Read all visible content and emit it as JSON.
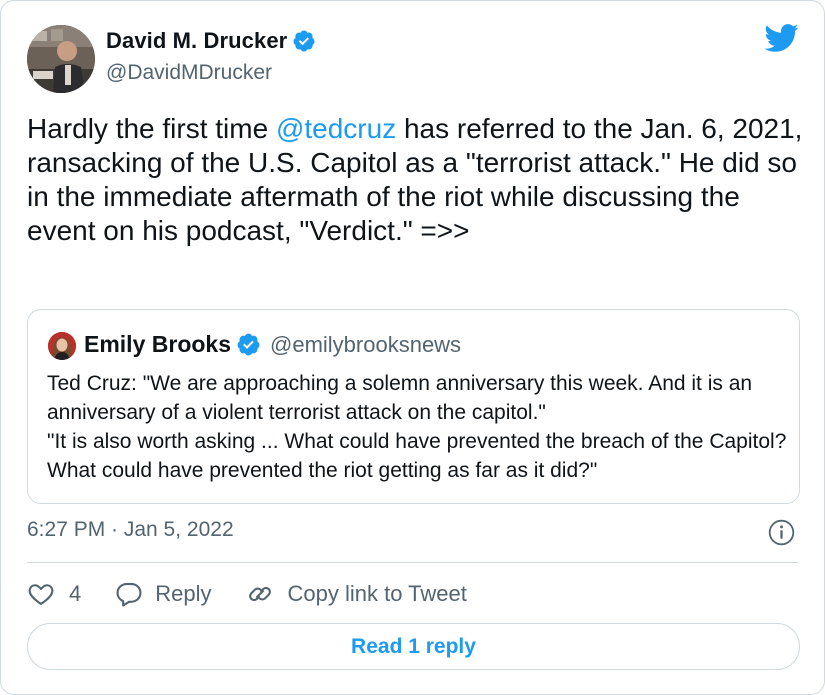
{
  "author": {
    "name": "David M. Drucker",
    "handle": "@DavidMDrucker"
  },
  "tweet": {
    "text_before": "Hardly the first time ",
    "mention": "@tedcruz",
    "text_after": " has referred to the Jan. 6, 2021, ransacking of the U.S. Capitol as a \"terrorist attack.\" He did so in the immediate aftermath of the riot while discussing the event on his podcast, \"Verdict.\" =>>"
  },
  "quoted_tweet": {
    "name": "Emily Brooks",
    "handle": "@emilybrooksnews",
    "text": "Ted Cruz: \"We are approaching a solemn anniversary this week. And it is an anniversary of a violent terrorist attack on the capitol.\"\n\"It is also worth asking ... What could have prevented the breach of the Capitol? What could have prevented the riot getting as far as it did?\""
  },
  "timestamp": "6:27 PM · Jan 5, 2022",
  "actions": {
    "like_count": "4",
    "reply_label": "Reply",
    "copy_label": "Copy link to Tweet"
  },
  "read_replies_label": "Read 1 reply",
  "icons": {
    "brand": "twitter-bird-icon",
    "verified": "verified-badge-icon",
    "info": "info-icon",
    "like": "heart-icon",
    "reply": "speech-bubble-icon",
    "copy": "link-icon"
  },
  "colors": {
    "accent": "#1d9bf0",
    "text": "#0f1419",
    "secondary": "#536471",
    "border": "#cfd9de"
  }
}
